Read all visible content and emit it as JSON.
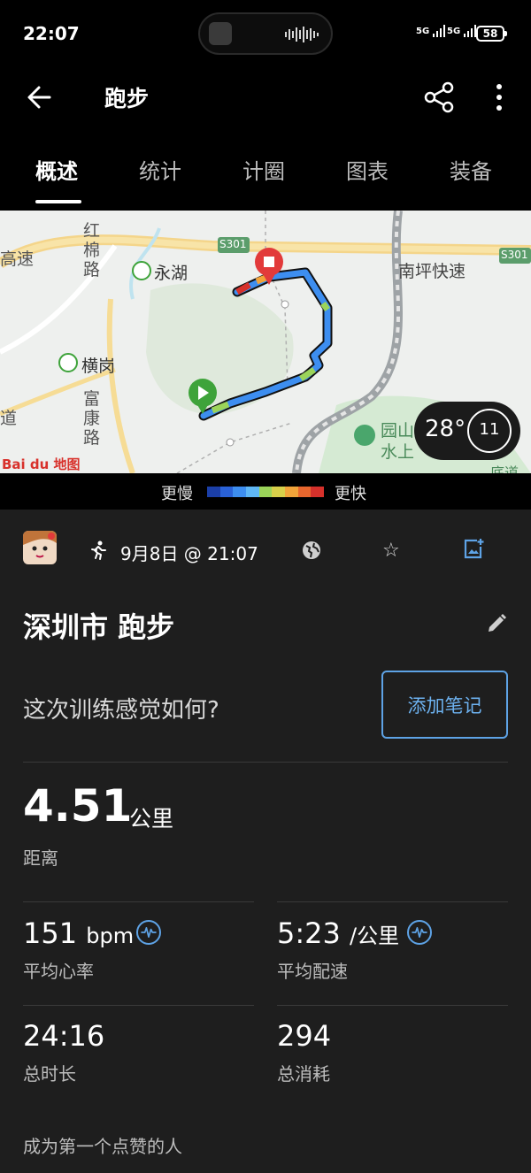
{
  "status_bar": {
    "time": "22:07",
    "signal1": "5G",
    "signal2": "5G",
    "battery": "58"
  },
  "app_bar": {
    "title": "跑步"
  },
  "tabs": [
    "概述",
    "统计",
    "计圈",
    "图表",
    "装备"
  ],
  "map": {
    "labels": {
      "road_hongmian": "红棉路",
      "metro_yonghu": "永湖",
      "metro_henggang": "横岗",
      "road_fukang": "富康路",
      "highway_nanping": "南坪快速",
      "s301_a": "S301",
      "s301_b": "S301",
      "park": "园山",
      "water": "水上",
      "highspeed": "高速",
      "road_left": "道",
      "bottom_right": "底道"
    },
    "logo": "Bai du 地图",
    "weather": {
      "temperature": "28°",
      "wind": "11"
    }
  },
  "legend": {
    "slow": "更慢",
    "fast": "更快",
    "colors": [
      "#1b3fa8",
      "#2a62d8",
      "#3d8ef0",
      "#5fb7f5",
      "#9bd45a",
      "#d8d04a",
      "#f2a43a",
      "#e8672e",
      "#d6312b"
    ]
  },
  "activity": {
    "date": "9月8日 @ 21:07",
    "title": "深圳市 跑步",
    "feel_prompt": "这次训练感觉如何?",
    "add_note": "添加笔记",
    "distance": {
      "value": "4.51",
      "unit": "公里",
      "label": "距离"
    },
    "heart_rate": {
      "value": "151",
      "unit": "bpm",
      "label": "平均心率"
    },
    "pace": {
      "value": "5:23",
      "unit": "/公里",
      "label": "平均配速"
    },
    "duration": {
      "value": "24:16",
      "label": "总时长"
    },
    "calories": {
      "value": "294",
      "label": "总消耗"
    },
    "likes": "成为第一个点赞的人"
  }
}
